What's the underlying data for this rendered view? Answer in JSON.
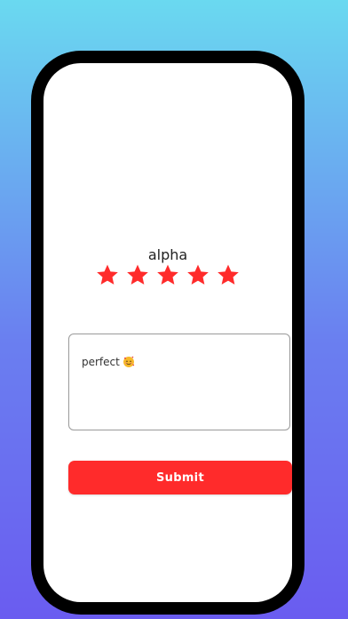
{
  "app": {
    "title": "alpha"
  },
  "rating": {
    "value": 5,
    "max": 5,
    "star_color": "#ff2b2b"
  },
  "review": {
    "text": "perfect",
    "emoji": "smiling-face-with-hearts"
  },
  "actions": {
    "submit_label": "Submit",
    "submit_color": "#ff2b2b"
  },
  "background": {
    "gradient_top": "#6ad9f0",
    "gradient_bottom": "#6a5cf0"
  }
}
